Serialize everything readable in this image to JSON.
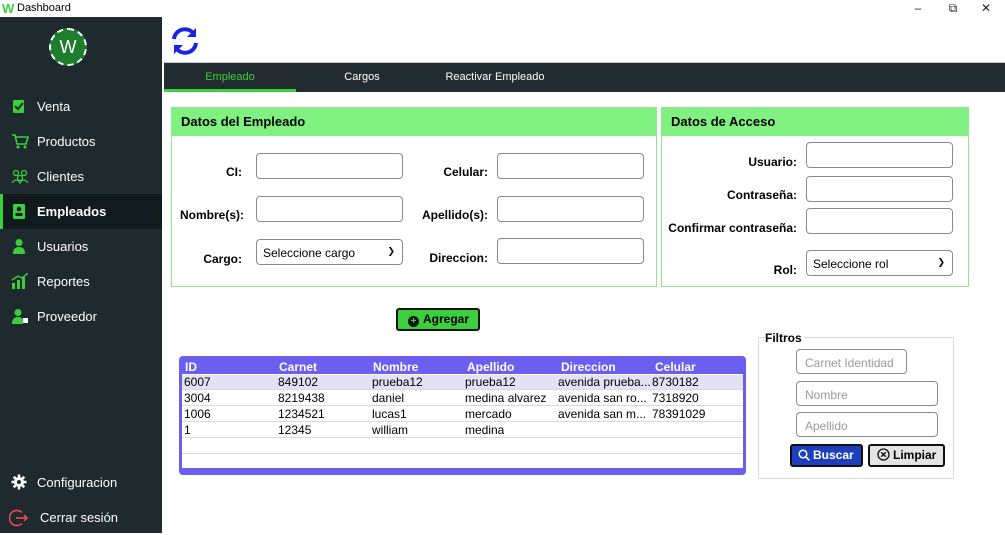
{
  "window": {
    "app_icon": "W",
    "title": "Dashboard",
    "minimize": "–",
    "restore": "⧉",
    "close": "✕"
  },
  "sidebar": {
    "logo": "W",
    "items": [
      {
        "label": "Venta",
        "icon": "cart-receipt-icon"
      },
      {
        "label": "Productos",
        "icon": "shopping-cart-icon"
      },
      {
        "label": "Clientes",
        "icon": "clients-group-icon"
      },
      {
        "label": "Empleados",
        "icon": "employee-badge-icon",
        "active": true
      },
      {
        "label": "Usuarios",
        "icon": "user-icon"
      },
      {
        "label": "Reportes",
        "icon": "chart-icon"
      },
      {
        "label": "Proveedor",
        "icon": "supplier-icon"
      }
    ],
    "bottom": [
      {
        "label": "Configuracion",
        "icon": "gear-icon"
      },
      {
        "label": "Cerrar sesión",
        "icon": "logout-icon"
      }
    ]
  },
  "tabs": [
    {
      "label": "Empleado",
      "active": true
    },
    {
      "label": "Cargos"
    },
    {
      "label": "Reactivar Empleado"
    }
  ],
  "empleado_panel": {
    "title": "Datos del Empleado",
    "ci_label": "CI:",
    "celular_label": "Celular:",
    "nombres_label": "Nombre(s):",
    "apellidos_label": "Apellido(s):",
    "cargo_label": "Cargo:",
    "cargo_value": "Seleccione cargo",
    "direccion_label": "Direccion:"
  },
  "acceso_panel": {
    "title": "Datos de Acceso",
    "usuario_label": "Usuario:",
    "contrasena_label": "Contraseña:",
    "confirmar_label": "Confirmar contraseña:",
    "rol_label": "Rol:",
    "rol_value": "Seleccione rol"
  },
  "agregar_label": "Agregar",
  "table": {
    "headers": [
      "ID",
      "Carnet",
      "Nombre",
      "Apellido",
      "Direccion",
      "Celular"
    ],
    "rows": [
      [
        "6007",
        "849102",
        "prueba12",
        "prueba12",
        "avenida prueba...",
        "8730182"
      ],
      [
        "3004",
        "8219438",
        "daniel",
        "medina alvarez",
        "avenida san ro...",
        "7318920"
      ],
      [
        "1006",
        "1234521",
        "lucas1",
        "mercado",
        "avenida san m...",
        "78391029"
      ],
      [
        "1",
        "12345",
        "william",
        "medina",
        "",
        ""
      ]
    ]
  },
  "filtros": {
    "title": "Filtros",
    "carnet_placeholder": "Carnet Identidad",
    "nombre_placeholder": "Nombre",
    "apellido_placeholder": "Apellido",
    "buscar_label": "Buscar",
    "limpiar_label": "Limpiar"
  },
  "colors": {
    "accent_green": "#3ccf3c",
    "panel_header": "#80f080",
    "sidebar_bg": "#1e2a2e",
    "table_purple": "#6b5ff0",
    "buscar_blue": "#1e3fbd"
  }
}
